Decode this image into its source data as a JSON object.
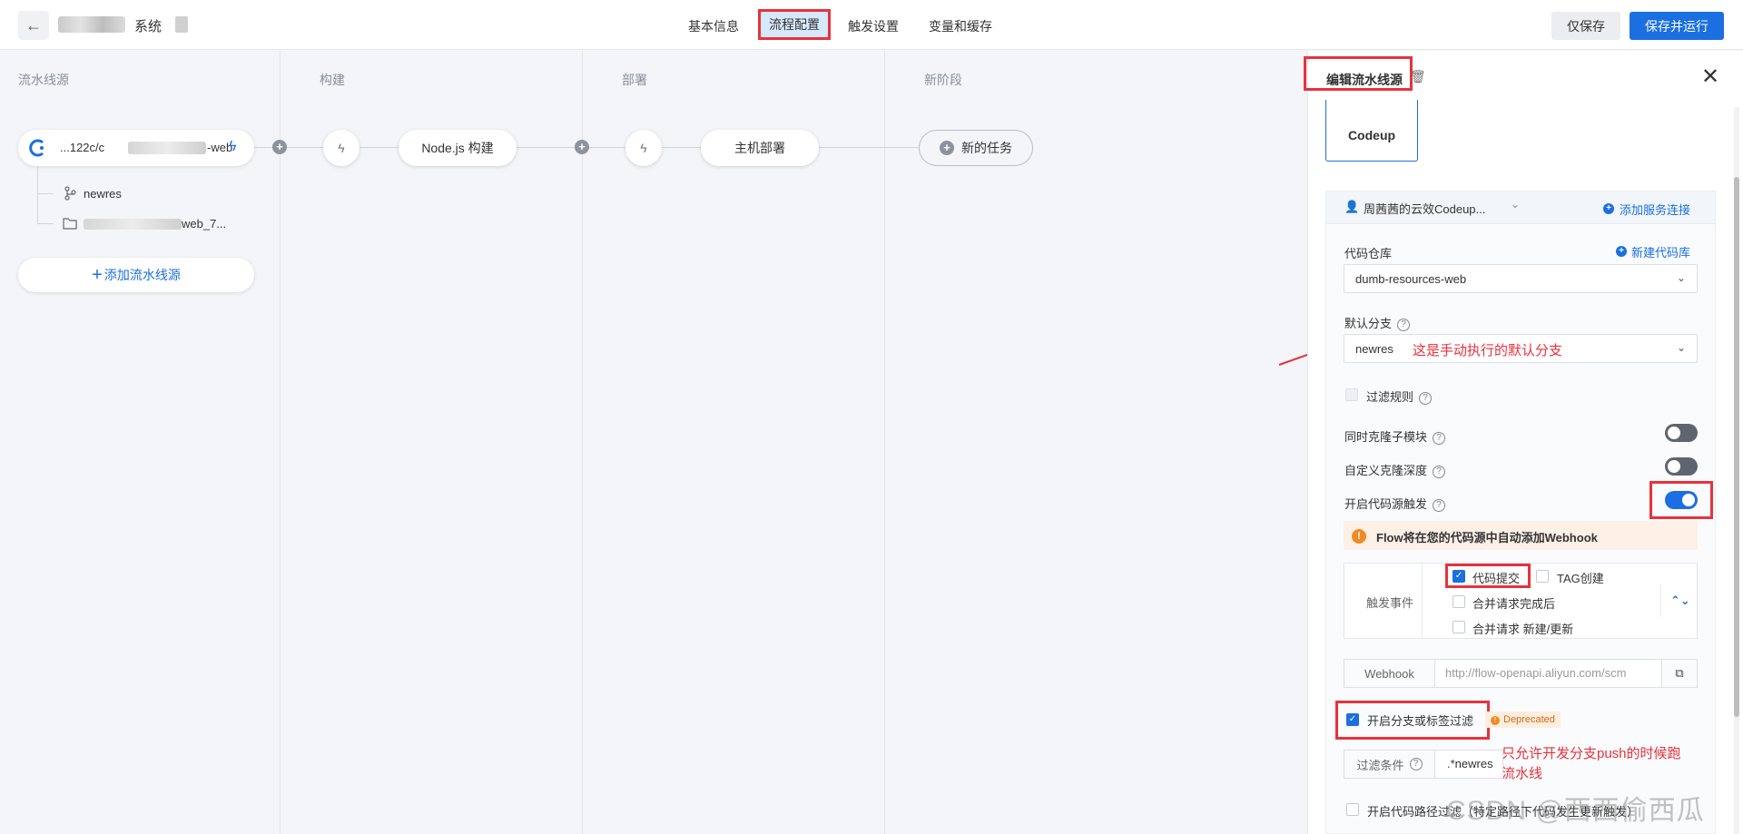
{
  "header": {
    "back_icon": "arrow-left-icon",
    "title_visible": "系统",
    "tabs": [
      {
        "label": "基本信息"
      },
      {
        "label": "流程配置"
      },
      {
        "label": "触发设置"
      },
      {
        "label": "变量和缓存"
      }
    ],
    "save_only": "仅保存",
    "save_and_run": "保存并运行"
  },
  "stages": [
    {
      "title": "流水线源"
    },
    {
      "title": "构建"
    },
    {
      "title": "部署"
    },
    {
      "title": "新阶段"
    }
  ],
  "source": {
    "name_prefix": "...122c/c",
    "name_suffix": "-web",
    "branch": "newres",
    "path_suffix": "web_7...",
    "add_label": "添加流水线源",
    "add_plus": "+"
  },
  "jobs": {
    "build": "Node.js 构建",
    "deploy": "主机部署",
    "new_task": "新的任务",
    "plus": "+"
  },
  "panel": {
    "title": "编辑流水线源",
    "source_type": "Codeup",
    "connection": "周茜茜的云效Codeup...",
    "add_connection": "添加服务连接",
    "repo_label": "代码仓库",
    "new_repo": "新建代码库",
    "repo_value": "dumb-resources-web",
    "branch_label": "默认分支",
    "branch_value": "newres",
    "branch_note": "这是手动执行的默认分支",
    "filter_rules": "过滤规则",
    "clone_submodules": "同时克隆子模块",
    "clone_depth": "自定义克隆深度",
    "enable_trigger": "开启代码源触发",
    "webhook_notice": "Flow将在您的代码源中自动添加Webhook",
    "event_label": "触发事件",
    "events": [
      {
        "label": "代码提交",
        "checked": true
      },
      {
        "label": "TAG创建",
        "checked": false
      },
      {
        "label": "合并请求完成后",
        "checked": false
      },
      {
        "label": "合并请求 新建/更新",
        "checked": false
      }
    ],
    "webhook_label": "Webhook",
    "webhook_url": "http://flow-openapi.aliyun.com/scm",
    "branch_filter": "开启分支或标签过滤",
    "deprecated": "Deprecated",
    "filter_note_line1": "只允许开发分支push的时候跑",
    "filter_note_line2": "流水线",
    "filter_cond_label": "过滤条件",
    "filter_cond_value": ".*newres",
    "path_filter": "开启代码路径过滤（特定路径下代码发生更新触发）",
    "toggles": {
      "clone_submodules": false,
      "clone_depth": false,
      "enable_trigger": true
    }
  },
  "watermark": "CSDN @西西偷西瓜",
  "colors": {
    "accent": "#1b6fe0",
    "annotation_red": "#e8323c",
    "warning": "#f08a24"
  }
}
